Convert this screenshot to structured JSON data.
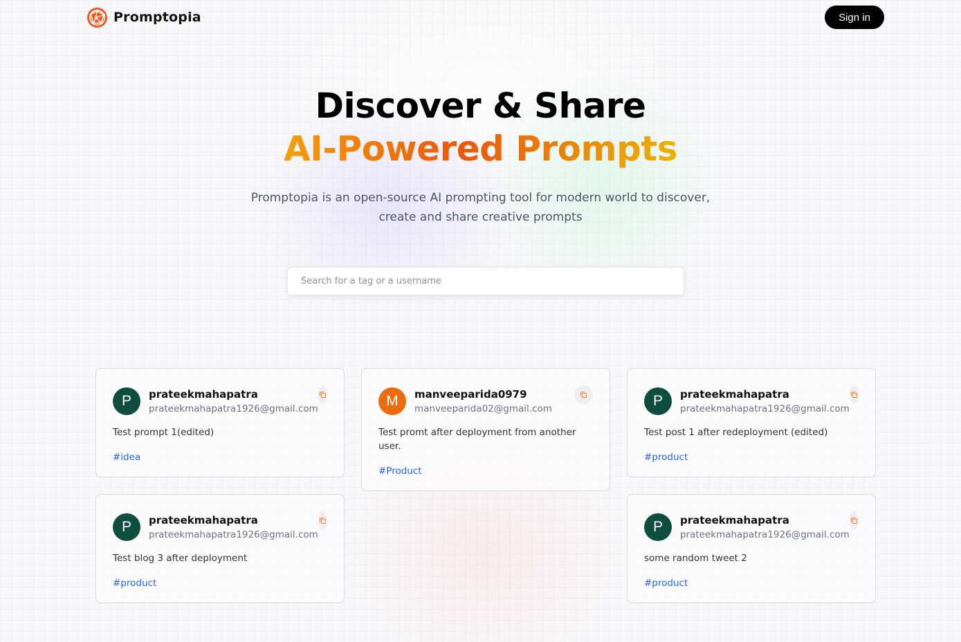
{
  "header": {
    "brand": "Promptopia",
    "signin_label": "Sign in"
  },
  "hero": {
    "title_line1": "Discover & Share",
    "title_line2": "AI-Powered Prompts",
    "subtitle": "Promptopia is an open-source AI prompting tool for modern world to discover, create and share creative prompts"
  },
  "search": {
    "placeholder": "Search for a tag or a username",
    "value": ""
  },
  "colors": {
    "avatar_green": "#0f4d3e",
    "avatar_orange": "#ea6c0f",
    "tag_blue": "#2563eb",
    "copy_icon": "#f97316"
  },
  "icons": {
    "logo": "network-globe-icon",
    "copy": "copy-icon"
  },
  "posts": [
    {
      "initial": "P",
      "username": "prateekmahapatra",
      "email": "prateekmahapatra1926@gmail.com",
      "prompt": "Test prompt 1(edited)",
      "tag": "#idea"
    },
    {
      "initial": "M",
      "username": "manveeparida0979",
      "email": "manveeparida02@gmail.com",
      "prompt": "Test promt after deployment from another user.",
      "tag": "#Product"
    },
    {
      "initial": "P",
      "username": "prateekmahapatra",
      "email": "prateekmahapatra1926@gmail.com",
      "prompt": "Test post 1 after redeployment (edited)",
      "tag": "#product"
    },
    {
      "initial": "P",
      "username": "prateekmahapatra",
      "email": "prateekmahapatra1926@gmail.com",
      "prompt": "Test blog 3 after deployment",
      "tag": "#product"
    },
    {
      "initial": "P",
      "username": "prateekmahapatra",
      "email": "prateekmahapatra1926@gmail.com",
      "prompt": "some random tweet 2",
      "tag": "#product"
    }
  ]
}
